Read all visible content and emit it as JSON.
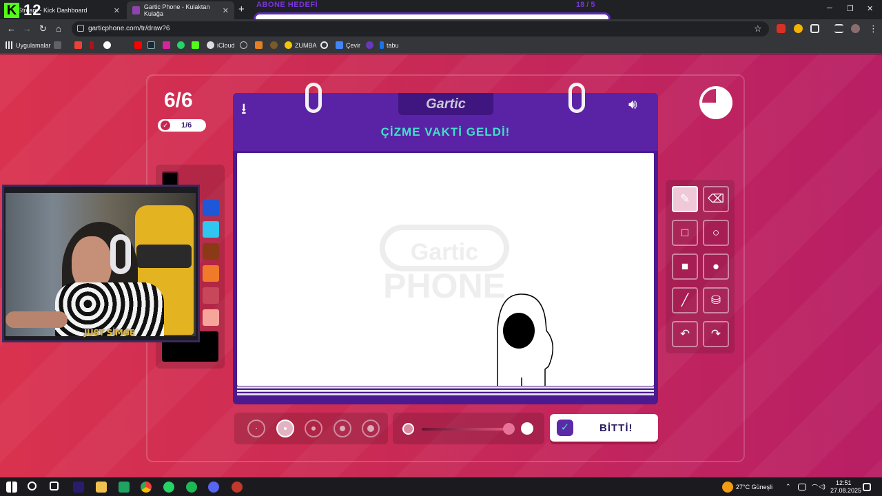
{
  "browser": {
    "tabs": [
      {
        "label": "Stream - Kick Dashboard",
        "active": false
      },
      {
        "label": "Gartic Phone - Kulaktan Kulağa",
        "active": true
      }
    ],
    "new_tab": "+",
    "url": "garticphone.com/tr/draw?6",
    "window_controls": {
      "minimize": "─",
      "restore": "❐",
      "close": "✕"
    }
  },
  "overlay": {
    "kick_logo": "K",
    "kick_count": "12",
    "goal_label": "ABONE HEDEFİ",
    "goal_count": "18 / 5"
  },
  "bookmarks": [
    {
      "label": "Uygulamalar",
      "icon": "apps-grid-icon",
      "color": "#e8eaed"
    },
    {
      "label": "iCloud",
      "icon": "cloud-icon",
      "color": "#e8eaed"
    },
    {
      "label": "ZUMBA",
      "icon": "zumba-icon",
      "color": "#f1c40f"
    },
    {
      "label": "Çevir",
      "icon": "translate-icon",
      "color": "#4285f4"
    },
    {
      "label": "tabu",
      "icon": "tabu-icon",
      "color": "#1a73e8"
    }
  ],
  "game": {
    "round": "6/6",
    "turn": "1/6",
    "logo": "Gartic",
    "headline": "ÇİZME VAKTİ GELDİ!",
    "watermark_top": "Gartic",
    "watermark_bottom": "PHONE",
    "done_label": "BİTTİ!",
    "timer_remaining_fraction": 0.75,
    "palette": [
      "#000000",
      "#1f57d6",
      "#2fc6f0",
      "#8a3a16",
      "#f07a2a",
      "#c9475a",
      "#f7a59a"
    ],
    "selected_color": "#000000",
    "brush_sizes": 5,
    "selected_brush_size": 2,
    "opacity_percent": 100,
    "tools": [
      {
        "name": "pencil-tool",
        "glyph": "✎",
        "active": true
      },
      {
        "name": "eraser-tool",
        "glyph": "⌫",
        "active": false
      },
      {
        "name": "rectangle-outline-tool",
        "glyph": "□",
        "active": false
      },
      {
        "name": "ellipse-outline-tool",
        "glyph": "○",
        "active": false
      },
      {
        "name": "rectangle-fill-tool",
        "glyph": "■",
        "active": false
      },
      {
        "name": "ellipse-fill-tool",
        "glyph": "●",
        "active": false
      },
      {
        "name": "line-tool",
        "glyph": "╱",
        "active": false
      },
      {
        "name": "bucket-fill-tool",
        "glyph": "⛁",
        "active": false
      },
      {
        "name": "undo-tool",
        "glyph": "↶",
        "active": false
      },
      {
        "name": "redo-tool",
        "glyph": "↷",
        "active": false
      }
    ]
  },
  "webcam": {
    "name": "JUST SİMGE"
  },
  "taskbar": {
    "weather": "27°C  Güneşli",
    "time": "12:51",
    "date": "27.08.2025"
  }
}
